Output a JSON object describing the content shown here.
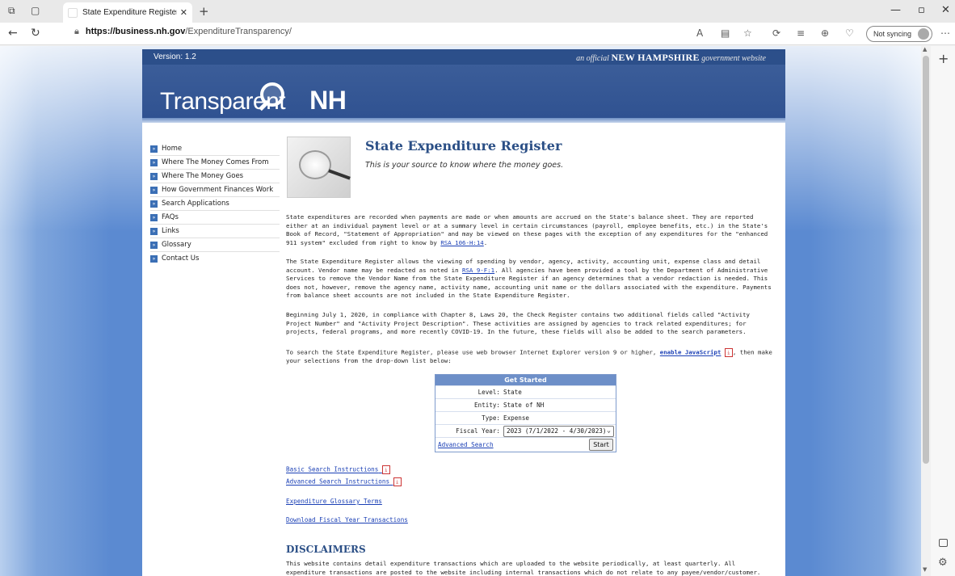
{
  "browser": {
    "tab_title": "State Expenditure Register - Tran",
    "url_host": "https://business.nh.gov",
    "url_path": "/ExpenditureTransparency/",
    "sync_label": "Not syncing"
  },
  "header": {
    "version": "Version: 1.2",
    "official_prefix": "an official",
    "official_state": "NEW HAMPSHIRE",
    "official_suffix": "government website",
    "logo_text": "Transparent",
    "logo_nh": "NH"
  },
  "nav": {
    "items": [
      {
        "label": "Home"
      },
      {
        "label": "Where The Money Comes From"
      },
      {
        "label": "Where The Money Goes"
      },
      {
        "label": "How Government Finances Work"
      },
      {
        "label": "Search Applications"
      },
      {
        "label": "FAQs"
      },
      {
        "label": "Links"
      },
      {
        "label": "Glossary"
      },
      {
        "label": "Contact Us"
      }
    ]
  },
  "main": {
    "title": "State Expenditure Register",
    "subtitle": "This is your source to know where the money goes.",
    "p1_a": "State expenditures are recorded when payments are made or when amounts are accrued on the State's balance sheet. They are reported either at an individual payment level or at a summary level in certain circumstances (payroll, employee benefits, etc.) in the State's Book of Record, \"Statement of Appropriation\" and may be viewed on these pages with the exception of any expenditures for the \"enhanced 911 system\" excluded from right to know by ",
    "p1_link": "RSA 106-H:14",
    "p1_b": ".",
    "p2_a": "The State Expenditure Register allows the viewing of spending by vendor, agency, activity, accounting unit, expense class and detail account. Vendor name may be redacted as noted in ",
    "p2_link": "RSA 9-F:1",
    "p2_b": ". All agencies have been provided a tool by the Department of Administrative Services to remove the Vendor Name from the State Expenditure Register if an agency determines that a vendor redaction is needed. This does not, however, remove the agency name, activity name, accounting unit name or the dollars associated with the expenditure. Payments from balance sheet accounts are not included in the State Expenditure Register.",
    "p3": "Beginning July 1, 2020, in compliance with Chapter 8, Laws 20, the Check Register contains two additional fields called \"Activity Project Number\" and \"Activity Project Description\". These activities are assigned by agencies to track related expenditures; for projects, federal programs, and more recently COVID-19. In the future, these fields will also be added to the search parameters.",
    "p4_a": "To search the State Expenditure Register, please use web browser Internet Explorer version 9 or higher, ",
    "p4_link": "enable JavaScript",
    "p4_b": ", then make your selections from the drop-down list below:",
    "disclaimers_title": "DISCLAIMERS",
    "disclaimer_text": "This website contains detail expenditure transactions which are uploaded to the website periodically, at least quarterly. All expenditure transactions are posted to the website including internal transactions which do not relate to any payee/vendor/customer. These non-vendor transactions will"
  },
  "get_started": {
    "header": "Get Started",
    "level_label": "Level:",
    "level_value": "State",
    "entity_label": "Entity:",
    "entity_value": "State of NH",
    "type_label": "Type:",
    "type_value": "Expense",
    "fy_label": "Fiscal Year:",
    "fy_value": "2023 (7/1/2022 - 4/30/2023)",
    "advanced_link": "Advanced Search",
    "start_label": "Start"
  },
  "links": {
    "basic": "Basic Search Instructions",
    "advanced": "Advanced Search Instructions",
    "glossary": "Expenditure Glossary Terms",
    "download": "Download Fiscal Year Transactions"
  },
  "colors": {
    "accent": "#2b4f86",
    "banner": "#2f5190",
    "link": "#1a3fb5"
  }
}
